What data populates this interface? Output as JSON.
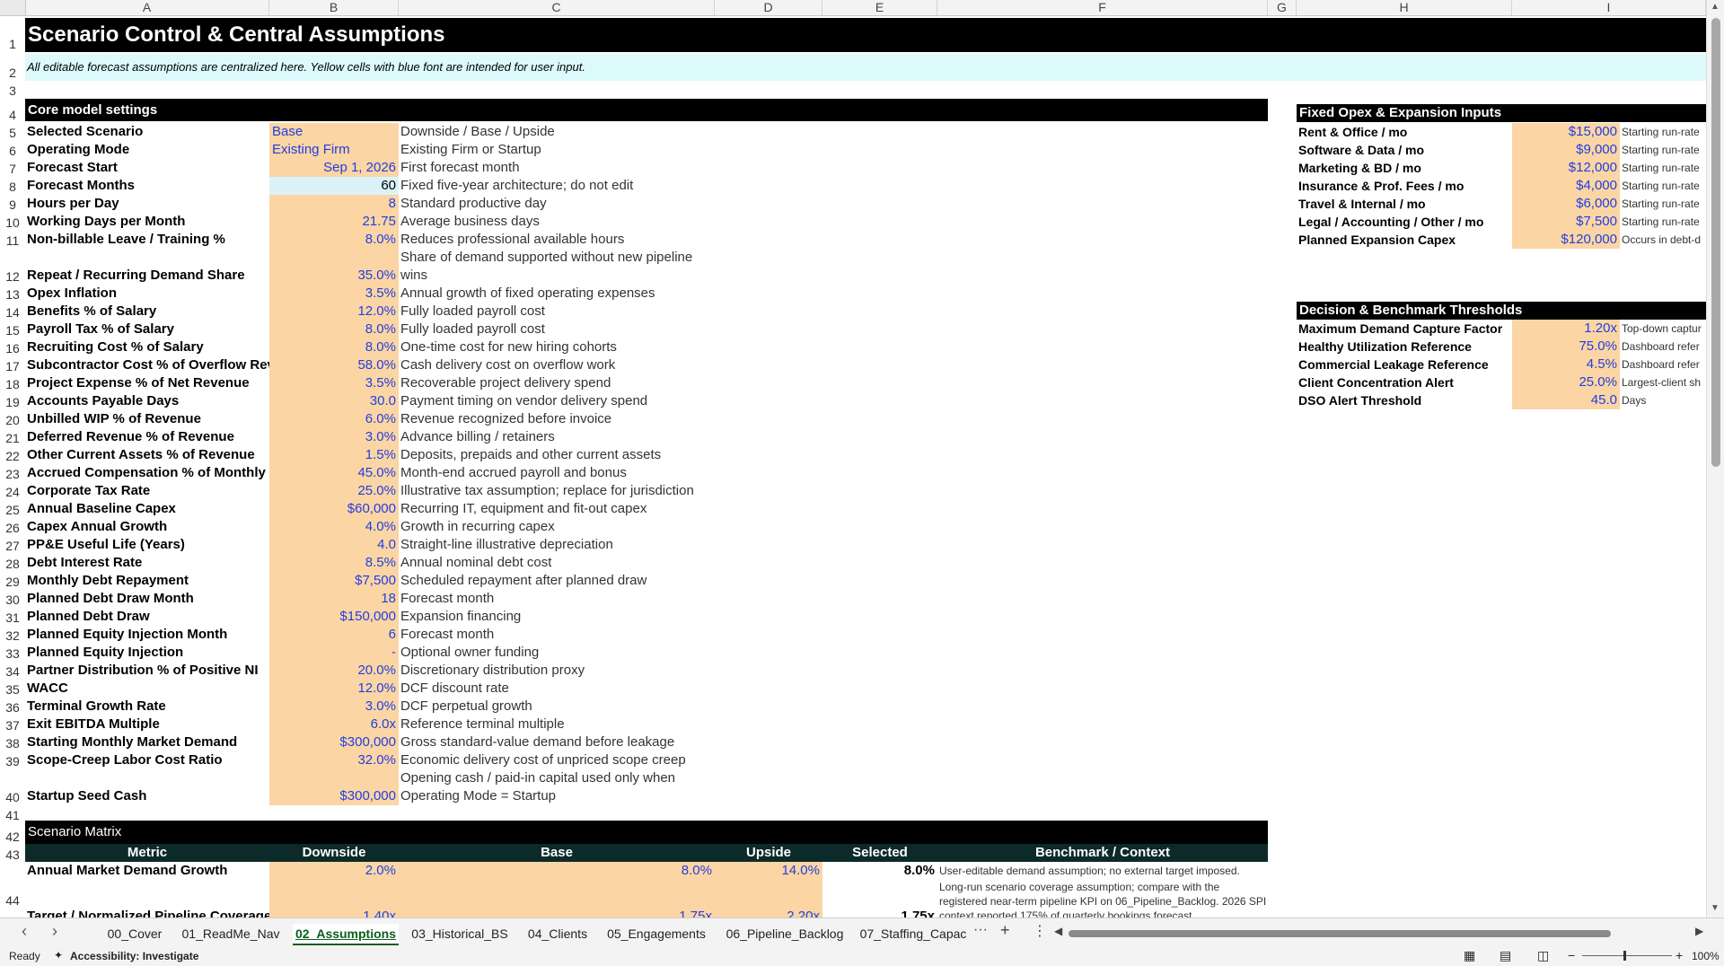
{
  "columns": [
    "A",
    "B",
    "C",
    "D",
    "E",
    "F",
    "G",
    "H",
    "I"
  ],
  "title": "Scenario Control & Central Assumptions",
  "note": "All editable forecast assumptions are centralized here. Yellow cells with blue font are intended for user input.",
  "core_header": "Core model settings",
  "rows": [
    {
      "r": "5",
      "label": "Selected Scenario",
      "value": "Base",
      "desc": "Downside / Base / Upside",
      "vtype": "text"
    },
    {
      "r": "6",
      "label": "Operating Mode",
      "value": "Existing Firm",
      "desc": "Existing Firm or Startup",
      "vtype": "text"
    },
    {
      "r": "7",
      "label": "Forecast Start",
      "value": "Sep 1, 2026",
      "desc": "First forecast month",
      "vtype": "num"
    },
    {
      "r": "8",
      "label": "Forecast Months",
      "value": "60",
      "desc": "Fixed five-year architecture; do not edit",
      "vtype": "calc"
    },
    {
      "r": "9",
      "label": "Hours per Day",
      "value": "8",
      "desc": "Standard productive day",
      "vtype": "num"
    },
    {
      "r": "10",
      "label": "Working Days per Month",
      "value": "21.75",
      "desc": "Average business days",
      "vtype": "num"
    },
    {
      "r": "11",
      "label": "Non-billable Leave / Training %",
      "value": "8.0%",
      "desc": "Reduces professional available hours",
      "vtype": "num"
    },
    {
      "r": "12",
      "label": "Repeat / Recurring Demand Share",
      "value": "35.0%",
      "desc": "Share of demand supported without new pipeline",
      "desc2": "wins",
      "vtype": "num",
      "tall": true
    },
    {
      "r": "13",
      "label": "Opex Inflation",
      "value": "3.5%",
      "desc": "Annual growth of fixed operating expenses",
      "vtype": "num"
    },
    {
      "r": "14",
      "label": "Benefits % of Salary",
      "value": "12.0%",
      "desc": "Fully loaded payroll cost",
      "vtype": "num"
    },
    {
      "r": "15",
      "label": "Payroll Tax % of Salary",
      "value": "8.0%",
      "desc": "Fully loaded payroll cost",
      "vtype": "num"
    },
    {
      "r": "16",
      "label": "Recruiting Cost % of Salary",
      "value": "8.0%",
      "desc": "One-time cost for new hiring cohorts",
      "vtype": "num"
    },
    {
      "r": "17",
      "label": "Subcontractor Cost % of Overflow Rev",
      "value": "58.0%",
      "desc": "Cash delivery cost on overflow work",
      "vtype": "num"
    },
    {
      "r": "18",
      "label": "Project Expense % of Net Revenue",
      "value": "3.5%",
      "desc": "Recoverable project delivery spend",
      "vtype": "num"
    },
    {
      "r": "19",
      "label": "Accounts Payable Days",
      "value": "30.0",
      "desc": "Payment timing on vendor delivery spend",
      "vtype": "num"
    },
    {
      "r": "20",
      "label": "Unbilled WIP % of Revenue",
      "value": "6.0%",
      "desc": "Revenue recognized before invoice",
      "vtype": "num"
    },
    {
      "r": "21",
      "label": "Deferred Revenue % of Revenue",
      "value": "3.0%",
      "desc": "Advance billing / retainers",
      "vtype": "num"
    },
    {
      "r": "22",
      "label": "Other Current Assets % of Revenue",
      "value": "1.5%",
      "desc": "Deposits, prepaids and other current assets",
      "vtype": "num"
    },
    {
      "r": "23",
      "label": "Accrued Compensation % of Monthly P",
      "value": "45.0%",
      "desc": "Month-end accrued payroll and bonus",
      "vtype": "num"
    },
    {
      "r": "24",
      "label": "Corporate Tax Rate",
      "value": "25.0%",
      "desc": "Illustrative tax assumption; replace for jurisdiction",
      "vtype": "num"
    },
    {
      "r": "25",
      "label": "Annual Baseline Capex",
      "value": "$60,000",
      "desc": "Recurring IT, equipment and fit-out capex",
      "vtype": "num"
    },
    {
      "r": "26",
      "label": "Capex Annual Growth",
      "value": "4.0%",
      "desc": "Growth in recurring capex",
      "vtype": "num"
    },
    {
      "r": "27",
      "label": "PP&E Useful Life (Years)",
      "value": "4.0",
      "desc": "Straight-line illustrative depreciation",
      "vtype": "num"
    },
    {
      "r": "28",
      "label": "Debt Interest Rate",
      "value": "8.5%",
      "desc": "Annual nominal debt cost",
      "vtype": "num"
    },
    {
      "r": "29",
      "label": "Monthly Debt Repayment",
      "value": "$7,500",
      "desc": "Scheduled repayment after planned draw",
      "vtype": "num"
    },
    {
      "r": "30",
      "label": "Planned Debt Draw Month",
      "value": "18",
      "desc": "Forecast month",
      "vtype": "num"
    },
    {
      "r": "31",
      "label": "Planned Debt Draw",
      "value": "$150,000",
      "desc": "Expansion financing",
      "vtype": "num"
    },
    {
      "r": "32",
      "label": "Planned Equity Injection Month",
      "value": "6",
      "desc": "Forecast month",
      "vtype": "num"
    },
    {
      "r": "33",
      "label": "Planned Equity Injection",
      "value": "-",
      "desc": "Optional owner funding",
      "vtype": "num"
    },
    {
      "r": "34",
      "label": "Partner Distribution % of Positive NI",
      "value": "20.0%",
      "desc": "Discretionary distribution proxy",
      "vtype": "num"
    },
    {
      "r": "35",
      "label": "WACC",
      "value": "12.0%",
      "desc": "DCF discount rate",
      "vtype": "num"
    },
    {
      "r": "36",
      "label": "Terminal Growth Rate",
      "value": "3.0%",
      "desc": "DCF perpetual growth",
      "vtype": "num"
    },
    {
      "r": "37",
      "label": "Exit EBITDA Multiple",
      "value": "6.0x",
      "desc": "Reference terminal multiple",
      "vtype": "num"
    },
    {
      "r": "38",
      "label": "Starting Monthly Market Demand",
      "value": "$300,000",
      "desc": "Gross standard-value demand before leakage",
      "vtype": "num"
    },
    {
      "r": "39",
      "label": "Scope-Creep Labor Cost Ratio",
      "value": "32.0%",
      "desc": "Economic delivery cost of unpriced scope creep",
      "vtype": "num"
    },
    {
      "r": "40",
      "label": "Startup Seed Cash",
      "value": "$300,000",
      "desc": "Opening cash / paid-in capital used only when",
      "desc2": "Operating Mode = Startup",
      "vtype": "num",
      "tall": true
    }
  ],
  "opex_header": "Fixed Opex & Expansion Inputs",
  "opex": [
    {
      "label": "Rent & Office / mo",
      "value": "$15,000",
      "desc": "Starting run-rate"
    },
    {
      "label": "Software & Data / mo",
      "value": "$9,000",
      "desc": "Starting run-rate"
    },
    {
      "label": "Marketing & BD / mo",
      "value": "$12,000",
      "desc": "Starting run-rate"
    },
    {
      "label": "Insurance & Prof. Fees / mo",
      "value": "$4,000",
      "desc": "Starting run-rate"
    },
    {
      "label": "Travel & Internal / mo",
      "value": "$6,000",
      "desc": "Starting run-rate"
    },
    {
      "label": "Legal / Accounting / Other / mo",
      "value": "$7,500",
      "desc": "Starting run-rate"
    },
    {
      "label": "Planned Expansion Capex",
      "value": "$120,000",
      "desc": "Occurs in debt-d"
    }
  ],
  "thresholds_header": "Decision & Benchmark Thresholds",
  "thresholds": [
    {
      "label": "Maximum Demand Capture Factor",
      "value": "1.20x",
      "desc": "Top-down captur"
    },
    {
      "label": "Healthy Utilization Reference",
      "value": "75.0%",
      "desc": "Dashboard refer"
    },
    {
      "label": "Commercial Leakage Reference",
      "value": "4.5%",
      "desc": "Dashboard refer"
    },
    {
      "label": "Client Concentration Alert",
      "value": "25.0%",
      "desc": "Largest-client sh"
    },
    {
      "label": "DSO Alert Threshold",
      "value": "45.0",
      "desc": "Days"
    }
  ],
  "matrix_header": "Scenario Matrix",
  "matrix_cols": {
    "metric": "Metric",
    "downside": "Downside",
    "base": "Base",
    "upside": "Upside",
    "selected": "Selected",
    "bench": "Benchmark / Context"
  },
  "matrix_rows": [
    {
      "label": "Annual Market Demand Growth",
      "downside": "2.0%",
      "base": "8.0%",
      "upside": "14.0%",
      "selected": "8.0%",
      "bench": "User-editable demand assumption; no external target imposed."
    },
    {
      "label": "Target / Normalized Pipeline Coverage",
      "downside": "1.40x",
      "base": "1.75x",
      "upside": "2.20x",
      "selected": "1.75x",
      "bench": "Long-run scenario coverage assumption; compare with the registered near-term pipeline KPI on 06_Pipeline_Backlog. 2026 SPI context reported 175% of quarterly bookings forecast."
    }
  ],
  "tabs": [
    "00_Cover",
    "01_ReadMe_Nav",
    "02_Assumptions",
    "03_Historical_BS",
    "04_Clients",
    "05_Engagements",
    "06_Pipeline_Backlog",
    "07_Staffing_Capac"
  ],
  "active_tab": "02_Assumptions",
  "status": {
    "ready": "Ready",
    "accessibility": "Accessibility: Investigate",
    "zoom": "100%"
  }
}
